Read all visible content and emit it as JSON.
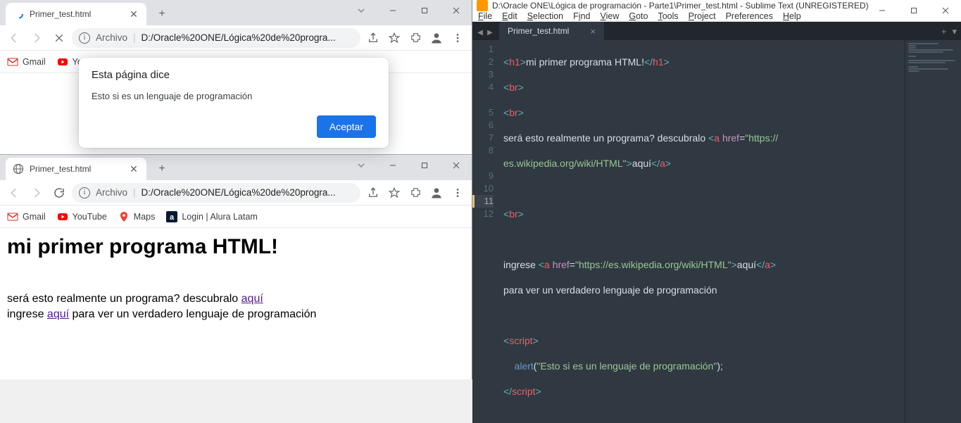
{
  "chrome_top": {
    "tab_title": "Primer_test.html",
    "address_scheme": "Archivo",
    "address_path": "D:/Oracle%20ONE/Lógica%20de%20progra...",
    "bookmarks": [
      {
        "label": "Gmail",
        "icon": "gmail"
      },
      {
        "label": "Yo...",
        "icon": "youtube"
      }
    ],
    "alert": {
      "title": "Esta página dice",
      "message": "Esto si es un lenguaje de programación",
      "ok_label": "Aceptar"
    }
  },
  "chrome_bottom": {
    "tab_title": "Primer_test.html",
    "address_scheme": "Archivo",
    "address_path": "D:/Oracle%20ONE/Lógica%20de%20progra...",
    "bookmarks": [
      {
        "label": "Gmail",
        "icon": "gmail"
      },
      {
        "label": "YouTube",
        "icon": "youtube"
      },
      {
        "label": "Maps",
        "icon": "maps"
      },
      {
        "label": "Login | Alura Latam",
        "icon": "alura"
      }
    ],
    "page": {
      "h1": "mi primer programa HTML!",
      "line1_pre": "será esto realmente un programa? descubralo ",
      "line1_link": "aquí",
      "line2_pre": "ingrese ",
      "line2_link": "aquí",
      "line2_post": " para ver un verdadero lenguaje de programación"
    }
  },
  "sublime": {
    "title": "D:\\Oracle ONE\\Lógica de programación - Parte1\\Primer_test.html - Sublime Text (UNREGISTERED)",
    "menus": [
      "File",
      "Edit",
      "Selection",
      "Find",
      "View",
      "Goto",
      "Tools",
      "Project",
      "Preferences",
      "Help"
    ],
    "tab": "Primer_test.html",
    "lines": [
      "1",
      "2",
      "3",
      "4",
      "5",
      "6",
      "7",
      "8",
      "9",
      "10",
      "11",
      "12"
    ],
    "code": {
      "l1_text": "mi primer programa HTML!",
      "l4_text_a": "será esto realmente un programa? descubralo ",
      "l4_href": "https://",
      "l4b_href": "es.wikipedia.org/wiki/HTML",
      "l4_link": "aquí",
      "l8_text_a": "ingrese ",
      "l8_href": "https://es.wikipedia.org/wiki/HTML",
      "l8_link": "aquí",
      "l8b_text": "para ver un verdadero lenguaje de programación",
      "l11_func": "alert",
      "l11_str": "Esto si es un lenguaje de programación"
    }
  }
}
